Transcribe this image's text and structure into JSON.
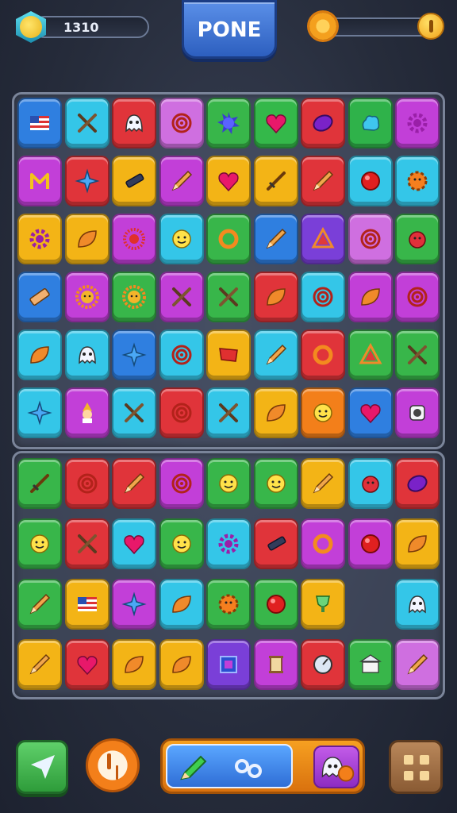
{
  "hud": {
    "score": "1310",
    "title": "PONE",
    "left_icon": "smiley-badge-icon",
    "right_icon": "gear-icon",
    "coin_icon": "coin-icon"
  },
  "board_top": [
    [
      [
        "#2f7fe0",
        "flag"
      ],
      [
        "#34c6e8",
        "crossed-swords"
      ],
      [
        "#e0343a",
        "ghost"
      ],
      [
        "#cf6fe0",
        "spiral"
      ],
      [
        "#38b64a",
        "spiky-ball"
      ],
      [
        "#34b84a",
        "heart"
      ],
      [
        "#e0343a",
        "gem"
      ],
      [
        "#2fb24a",
        "cloud-blob"
      ],
      [
        "#c23fd8",
        "gear"
      ]
    ],
    [
      [
        "#c23fd8",
        "letter-m"
      ],
      [
        "#e0343a",
        "star-spike"
      ],
      [
        "#f3b416",
        "pen-brush"
      ],
      [
        "#c23fd8",
        "pencil"
      ],
      [
        "#f3b416",
        "heart"
      ],
      [
        "#f3b416",
        "sword"
      ],
      [
        "#e0343a",
        "pencil"
      ],
      [
        "#34c6e8",
        "red-orb"
      ],
      [
        "#34c6e8",
        "gear-face"
      ]
    ],
    [
      [
        "#f3b416",
        "gear"
      ],
      [
        "#f3b416",
        "leaf"
      ],
      [
        "#c23fd8",
        "sunburst"
      ],
      [
        "#34c6e8",
        "smiley"
      ],
      [
        "#38b64a",
        "ring"
      ],
      [
        "#2f7fe0",
        "pencil"
      ],
      [
        "#7a3fd8",
        "triangle"
      ],
      [
        "#cf6fe0",
        "spiral"
      ],
      [
        "#38b64a",
        "face-ball"
      ]
    ],
    [
      [
        "#2f7fe0",
        "eraser"
      ],
      [
        "#c23fd8",
        "sun-face"
      ],
      [
        "#38b64a",
        "sun-face"
      ],
      [
        "#c23fd8",
        "crossed-swords"
      ],
      [
        "#38b64a",
        "crossed-swords"
      ],
      [
        "#e0343a",
        "leaf"
      ],
      [
        "#34c6e8",
        "spiral"
      ],
      [
        "#c23fd8",
        "leaf"
      ],
      [
        "#c23fd8",
        "spiral"
      ]
    ],
    [
      [
        "#34c6e8",
        "leaf"
      ],
      [
        "#34c6e8",
        "ghost"
      ],
      [
        "#2f7fe0",
        "star-spike"
      ],
      [
        "#34c6e8",
        "spiral"
      ],
      [
        "#f3b416",
        "flag-red"
      ],
      [
        "#34c6e8",
        "pencil"
      ],
      [
        "#e0343a",
        "ring"
      ],
      [
        "#38b64a",
        "triangle"
      ],
      [
        "#38b64a",
        "crossed-swords"
      ]
    ],
    [
      [
        "#34c6e8",
        "star-spike"
      ],
      [
        "#c23fd8",
        "gnome"
      ],
      [
        "#34c6e8",
        "crossed-swords"
      ],
      [
        "#e0343a",
        "spiral"
      ],
      [
        "#34c6e8",
        "crossed-swords"
      ],
      [
        "#f3b416",
        "leaf"
      ],
      [
        "#f37f1a",
        "smiley"
      ],
      [
        "#2f7fe0",
        "heart"
      ],
      [
        "#c23fd8",
        "robot"
      ]
    ]
  ],
  "board_bottom": [
    [
      [
        "#38b64a",
        "sword"
      ],
      [
        "#e0343a",
        "spiral"
      ],
      [
        "#e0343a",
        "pencil"
      ],
      [
        "#c23fd8",
        "spiral"
      ],
      [
        "#38b64a",
        "smiley"
      ],
      [
        "#38b64a",
        "smiley"
      ],
      [
        "#f3b416",
        "pencil"
      ],
      [
        "#34c6e8",
        "face-ball"
      ],
      [
        "#e0343a",
        "gem"
      ]
    ],
    [
      [
        "#38b64a",
        "smiley"
      ],
      [
        "#e0343a",
        "crossed-swords"
      ],
      [
        "#34c6e8",
        "heart"
      ],
      [
        "#38b64a",
        "smiley"
      ],
      [
        "#34c6e8",
        "gear"
      ],
      [
        "#e0343a",
        "pen-brush"
      ],
      [
        "#c23fd8",
        "ring"
      ],
      [
        "#c23fd8",
        "red-orb"
      ],
      [
        "#f3b416",
        "leaf"
      ]
    ],
    [
      [
        "#38b64a",
        "pencil"
      ],
      [
        "#f3b416",
        "flag"
      ],
      [
        "#c23fd8",
        "star-spike"
      ],
      [
        "#34c6e8",
        "leaf"
      ],
      [
        "#38b64a",
        "gear-face"
      ],
      [
        "#38b64a",
        "red-orb"
      ],
      [
        "#f3b416",
        "trophy"
      ],
      [
        "",
        ""
      ],
      [
        "#34c6e8",
        "ghost"
      ]
    ],
    [
      [
        "#f3b416",
        "pencil"
      ],
      [
        "#e0343a",
        "heart"
      ],
      [
        "#f3b416",
        "leaf"
      ],
      [
        "#f3b416",
        "leaf"
      ],
      [
        "#7a3fd8",
        "frame"
      ],
      [
        "#c23fd8",
        "scroll"
      ],
      [
        "#e0343a",
        "compass"
      ],
      [
        "#38b64a",
        "building"
      ],
      [
        "#cf6fe0",
        "pencil"
      ]
    ]
  ],
  "bottom_bar": {
    "share_icon": "share-arrow-icon",
    "timer_icon": "clock-icon",
    "power_icons": [
      "pencil-icon",
      "infinity-icon",
      "ghost-bomb-icon"
    ],
    "menu_icon": "grid-menu-icon"
  }
}
